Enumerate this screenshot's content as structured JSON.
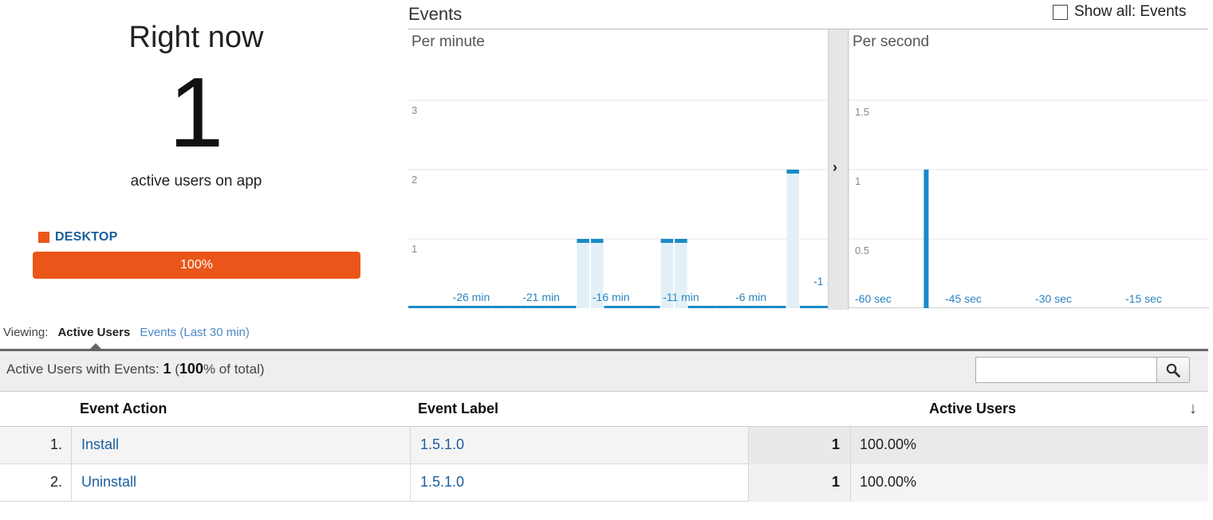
{
  "right_now": {
    "title": "Right now",
    "count": "1",
    "subtitle": "active users on app",
    "device": {
      "name": "DESKTOP",
      "percent_label": "100%",
      "color": "#ea5619"
    }
  },
  "events_panel": {
    "title": "Events",
    "show_all_label": "Show all: Events",
    "per_minute_label": "Per minute",
    "per_second_label": "Per second"
  },
  "viewing": {
    "label": "Viewing:",
    "active_tab": "Active Users",
    "other_tab": "Events (Last 30 min)"
  },
  "summary": {
    "prefix": "Active Users with Events: ",
    "value": "1",
    "pct": "100",
    "suffix": "% of total)"
  },
  "table": {
    "headers": {
      "action": "Event Action",
      "label": "Event Label",
      "users": "Active Users"
    },
    "rows": [
      {
        "num": "1.",
        "action": "Install",
        "label": "1.5.1.0",
        "users": "1",
        "pct": "100.00%"
      },
      {
        "num": "2.",
        "action": "Uninstall",
        "label": "1.5.1.0",
        "users": "1",
        "pct": "100.00%"
      }
    ]
  },
  "chart_data": [
    {
      "type": "bar",
      "subtitle": "Per minute",
      "yticks": [
        "1",
        "2",
        "3"
      ],
      "ylim": [
        0,
        3
      ],
      "xticks": [
        "-26 min",
        "-21 min",
        "-16 min",
        "-11 min",
        "-6 min",
        "-1 ..."
      ],
      "x_minutes_ago": [
        30,
        29,
        28,
        27,
        26,
        25,
        24,
        23,
        22,
        21,
        20,
        19,
        18,
        17,
        16,
        15,
        14,
        13,
        12,
        11,
        10,
        9,
        8,
        7,
        6,
        5,
        4,
        3,
        2,
        1
      ],
      "values": [
        0,
        0,
        0,
        0,
        0,
        0,
        0,
        0,
        0,
        0,
        0,
        0,
        1,
        1,
        0,
        0,
        0,
        0,
        1,
        1,
        0,
        0,
        0,
        0,
        0,
        0,
        0,
        2,
        0,
        0
      ],
      "bar_color": "#1a8ac8"
    },
    {
      "type": "bar",
      "subtitle": "Per second",
      "yticks": [
        "0.5",
        "1",
        "1.5"
      ],
      "ylim": [
        0,
        1.5
      ],
      "xticks": [
        "-60 sec",
        "-45 sec",
        "-30 sec",
        "-15 sec"
      ],
      "spike_seconds_ago": 48,
      "spike_value": 1,
      "bar_color": "#1a8ac8"
    }
  ]
}
